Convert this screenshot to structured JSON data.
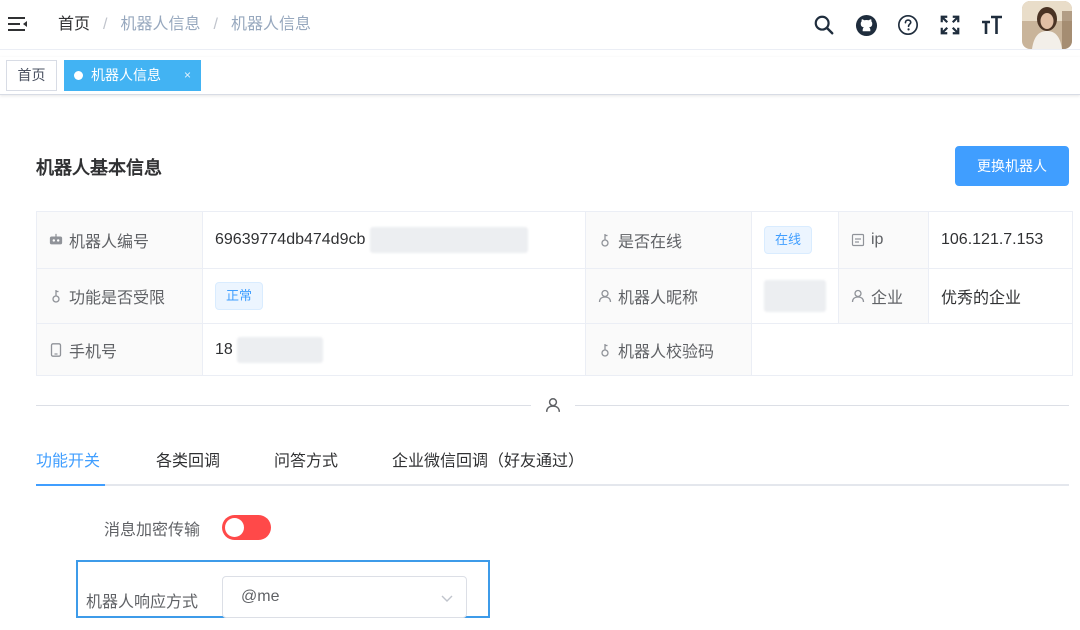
{
  "header": {
    "breadcrumb": {
      "home": "首页",
      "separator": "/",
      "level2": "机器人信息",
      "level3": "机器人信息"
    },
    "icons": [
      "search-icon",
      "github-icon",
      "help-icon",
      "fullscreen-icon",
      "font-size-icon"
    ]
  },
  "tags_view": {
    "home": "首页",
    "active": "机器人信息",
    "close": "×"
  },
  "panel": {
    "title": "机器人基本信息",
    "change_button": "更换机器人"
  },
  "info": {
    "robot_id_label": "机器人编号",
    "robot_id_value": "69639774db474d9cb",
    "online_label": "是否在线",
    "online_value": "在线",
    "ip_label": "ip",
    "ip_value": "106.121.7.153",
    "limited_label": "功能是否受限",
    "limited_value": "正常",
    "nickname_label": "机器人昵称",
    "company_label": "企业",
    "company_value": "优秀的企业",
    "phone_label": "手机号",
    "phone_value": "18",
    "verify_label": "机器人校验码"
  },
  "tabs": [
    "功能开关",
    "各类回调",
    "问答方式",
    "企业微信回调（好友通过）"
  ],
  "form": {
    "encrypt_label": "消息加密传输",
    "response_label": "机器人响应方式",
    "response_value": "@me"
  },
  "colors": {
    "primary": "#409eff",
    "tag_active": "#42b3f3",
    "switch_off": "#ff4949",
    "highlight": "#3d9be9"
  }
}
